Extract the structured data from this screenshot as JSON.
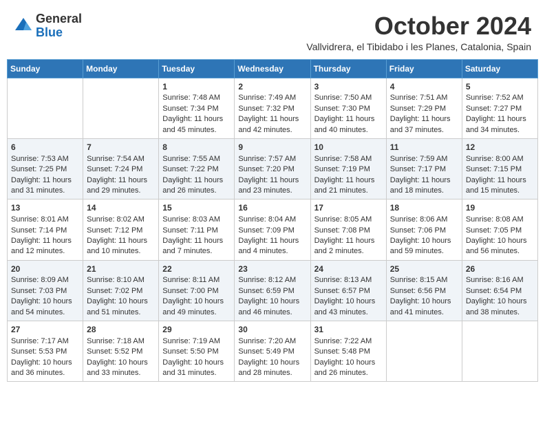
{
  "header": {
    "logo_general": "General",
    "logo_blue": "Blue",
    "month_title": "October 2024",
    "subtitle": "Vallvidrera, el Tibidabo i les Planes, Catalonia, Spain"
  },
  "days_of_week": [
    "Sunday",
    "Monday",
    "Tuesday",
    "Wednesday",
    "Thursday",
    "Friday",
    "Saturday"
  ],
  "weeks": [
    [
      {
        "day": "",
        "content": ""
      },
      {
        "day": "",
        "content": ""
      },
      {
        "day": "1",
        "content": "Sunrise: 7:48 AM\nSunset: 7:34 PM\nDaylight: 11 hours and 45 minutes."
      },
      {
        "day": "2",
        "content": "Sunrise: 7:49 AM\nSunset: 7:32 PM\nDaylight: 11 hours and 42 minutes."
      },
      {
        "day": "3",
        "content": "Sunrise: 7:50 AM\nSunset: 7:30 PM\nDaylight: 11 hours and 40 minutes."
      },
      {
        "day": "4",
        "content": "Sunrise: 7:51 AM\nSunset: 7:29 PM\nDaylight: 11 hours and 37 minutes."
      },
      {
        "day": "5",
        "content": "Sunrise: 7:52 AM\nSunset: 7:27 PM\nDaylight: 11 hours and 34 minutes."
      }
    ],
    [
      {
        "day": "6",
        "content": "Sunrise: 7:53 AM\nSunset: 7:25 PM\nDaylight: 11 hours and 31 minutes."
      },
      {
        "day": "7",
        "content": "Sunrise: 7:54 AM\nSunset: 7:24 PM\nDaylight: 11 hours and 29 minutes."
      },
      {
        "day": "8",
        "content": "Sunrise: 7:55 AM\nSunset: 7:22 PM\nDaylight: 11 hours and 26 minutes."
      },
      {
        "day": "9",
        "content": "Sunrise: 7:57 AM\nSunset: 7:20 PM\nDaylight: 11 hours and 23 minutes."
      },
      {
        "day": "10",
        "content": "Sunrise: 7:58 AM\nSunset: 7:19 PM\nDaylight: 11 hours and 21 minutes."
      },
      {
        "day": "11",
        "content": "Sunrise: 7:59 AM\nSunset: 7:17 PM\nDaylight: 11 hours and 18 minutes."
      },
      {
        "day": "12",
        "content": "Sunrise: 8:00 AM\nSunset: 7:15 PM\nDaylight: 11 hours and 15 minutes."
      }
    ],
    [
      {
        "day": "13",
        "content": "Sunrise: 8:01 AM\nSunset: 7:14 PM\nDaylight: 11 hours and 12 minutes."
      },
      {
        "day": "14",
        "content": "Sunrise: 8:02 AM\nSunset: 7:12 PM\nDaylight: 11 hours and 10 minutes."
      },
      {
        "day": "15",
        "content": "Sunrise: 8:03 AM\nSunset: 7:11 PM\nDaylight: 11 hours and 7 minutes."
      },
      {
        "day": "16",
        "content": "Sunrise: 8:04 AM\nSunset: 7:09 PM\nDaylight: 11 hours and 4 minutes."
      },
      {
        "day": "17",
        "content": "Sunrise: 8:05 AM\nSunset: 7:08 PM\nDaylight: 11 hours and 2 minutes."
      },
      {
        "day": "18",
        "content": "Sunrise: 8:06 AM\nSunset: 7:06 PM\nDaylight: 10 hours and 59 minutes."
      },
      {
        "day": "19",
        "content": "Sunrise: 8:08 AM\nSunset: 7:05 PM\nDaylight: 10 hours and 56 minutes."
      }
    ],
    [
      {
        "day": "20",
        "content": "Sunrise: 8:09 AM\nSunset: 7:03 PM\nDaylight: 10 hours and 54 minutes."
      },
      {
        "day": "21",
        "content": "Sunrise: 8:10 AM\nSunset: 7:02 PM\nDaylight: 10 hours and 51 minutes."
      },
      {
        "day": "22",
        "content": "Sunrise: 8:11 AM\nSunset: 7:00 PM\nDaylight: 10 hours and 49 minutes."
      },
      {
        "day": "23",
        "content": "Sunrise: 8:12 AM\nSunset: 6:59 PM\nDaylight: 10 hours and 46 minutes."
      },
      {
        "day": "24",
        "content": "Sunrise: 8:13 AM\nSunset: 6:57 PM\nDaylight: 10 hours and 43 minutes."
      },
      {
        "day": "25",
        "content": "Sunrise: 8:15 AM\nSunset: 6:56 PM\nDaylight: 10 hours and 41 minutes."
      },
      {
        "day": "26",
        "content": "Sunrise: 8:16 AM\nSunset: 6:54 PM\nDaylight: 10 hours and 38 minutes."
      }
    ],
    [
      {
        "day": "27",
        "content": "Sunrise: 7:17 AM\nSunset: 5:53 PM\nDaylight: 10 hours and 36 minutes."
      },
      {
        "day": "28",
        "content": "Sunrise: 7:18 AM\nSunset: 5:52 PM\nDaylight: 10 hours and 33 minutes."
      },
      {
        "day": "29",
        "content": "Sunrise: 7:19 AM\nSunset: 5:50 PM\nDaylight: 10 hours and 31 minutes."
      },
      {
        "day": "30",
        "content": "Sunrise: 7:20 AM\nSunset: 5:49 PM\nDaylight: 10 hours and 28 minutes."
      },
      {
        "day": "31",
        "content": "Sunrise: 7:22 AM\nSunset: 5:48 PM\nDaylight: 10 hours and 26 minutes."
      },
      {
        "day": "",
        "content": ""
      },
      {
        "day": "",
        "content": ""
      }
    ]
  ]
}
